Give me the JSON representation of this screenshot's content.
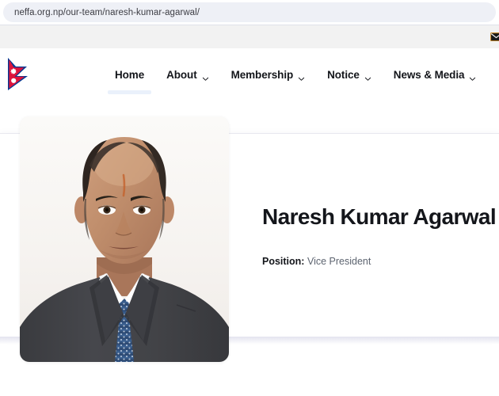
{
  "browser": {
    "url": "neffa.org.np/our-team/naresh-kumar-agarwal/"
  },
  "topbar": {
    "mail_icon": "mail-icon"
  },
  "header": {
    "logo_alt": "nepal-flag-logo",
    "nav": [
      {
        "label": "Home",
        "has_caret": false,
        "active": true
      },
      {
        "label": "About",
        "has_caret": true,
        "active": false
      },
      {
        "label": "Membership",
        "has_caret": true,
        "active": false
      },
      {
        "label": "Notice",
        "has_caret": true,
        "active": false
      },
      {
        "label": "News & Media",
        "has_caret": true,
        "active": false
      }
    ]
  },
  "profile": {
    "photo_alt": "naresh-kumar-agarwal-portrait",
    "name": "Naresh Kumar Agarwal",
    "position_label": "Position:",
    "position_value": "Vice President"
  },
  "colors": {
    "page_background": "#ffffff",
    "topbar_background": "#f2f2f2",
    "url_field_background": "#eef0f6",
    "side_panel": "#e9ebf6",
    "heading_text": "#14161b",
    "body_text": "#5d6470",
    "active_nav_underline": "#eaf1fb",
    "flag_crimson": "#dc143c",
    "flag_blue": "#003893"
  }
}
